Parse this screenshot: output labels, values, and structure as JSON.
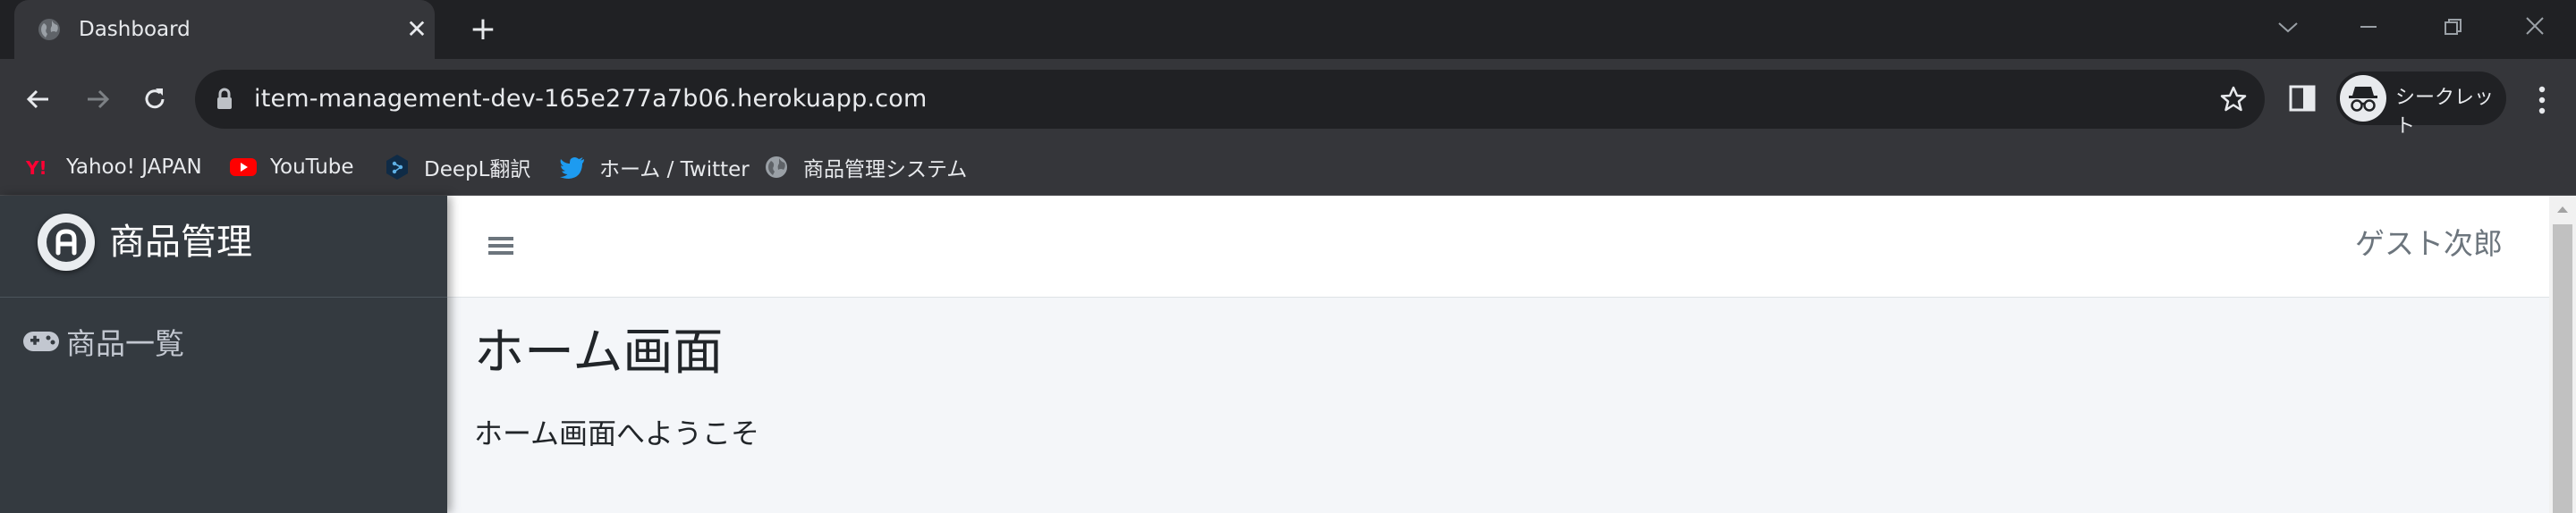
{
  "browser": {
    "tab": {
      "title": "Dashboard",
      "close_label": "✕"
    },
    "new_tab_label": "+",
    "url": "item-management-dev-165e277a7b06.herokuapp.com",
    "incognito_label": "シークレット",
    "bookmarks": [
      {
        "label": "Yahoo! JAPAN",
        "icon": "yahoo-icon"
      },
      {
        "label": "YouTube",
        "icon": "youtube-icon"
      },
      {
        "label": "DeepL翻訳",
        "icon": "deepl-icon"
      },
      {
        "label": "ホーム / Twitter",
        "icon": "twitter-icon"
      },
      {
        "label": "商品管理システム",
        "icon": "globe-icon"
      }
    ]
  },
  "app": {
    "brand": {
      "logo_letter": "A",
      "name": "商品管理"
    },
    "sidebar": {
      "items": [
        {
          "label": "商品一覧",
          "icon": "gamepad-icon"
        }
      ]
    },
    "header": {
      "user_name": "ゲスト次郎"
    },
    "main": {
      "title": "ホーム画面",
      "welcome": "ホーム画面へようこそ"
    }
  },
  "colors": {
    "sidebar_bg": "#343a40",
    "content_bg": "#f4f6f9",
    "header_bg": "#ffffff",
    "youtube_red": "#ff0000",
    "twitter_blue": "#1d9bf0",
    "yahoo_red": "#ff0033"
  }
}
